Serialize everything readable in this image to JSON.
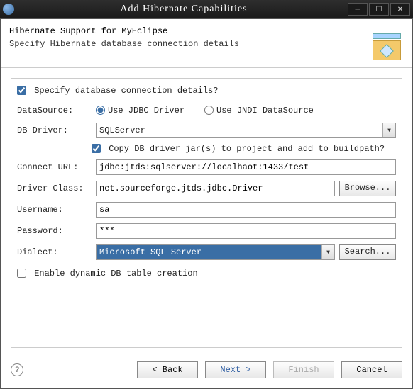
{
  "title": "Add Hibernate Capabilities",
  "header": {
    "heading": "Hibernate Support for MyEclipse",
    "sub": "Specify Hibernate database connection details"
  },
  "form": {
    "specify_label": "Specify database connection details?",
    "specify_checked": true,
    "datasource_label": "DataSource:",
    "ds_opt1": "Use JDBC Driver",
    "ds_opt2": "Use JNDI DataSource",
    "dbdriver_label": "DB Driver:",
    "dbdriver_value": "SQLServer",
    "copy_label": "Copy DB driver jar(s) to project and add to buildpath?",
    "copy_checked": true,
    "connecturl_label": "Connect URL:",
    "connecturl_value": "jdbc:jtds:sqlserver://localhaot:1433/test",
    "driverclass_label": "Driver Class:",
    "driverclass_value": "net.sourceforge.jtds.jdbc.Driver",
    "browse_btn": "Browse...",
    "username_label": "Username:",
    "username_value": "sa",
    "password_label": "Password:",
    "password_value": "***",
    "dialect_label": "Dialect:",
    "dialect_value": "Microsoft SQL Server",
    "search_btn": "Search...",
    "dynamic_label": "Enable dynamic DB table creation",
    "dynamic_checked": false
  },
  "footer": {
    "back": "< Back",
    "next": "Next >",
    "finish": "Finish",
    "cancel": "Cancel"
  }
}
